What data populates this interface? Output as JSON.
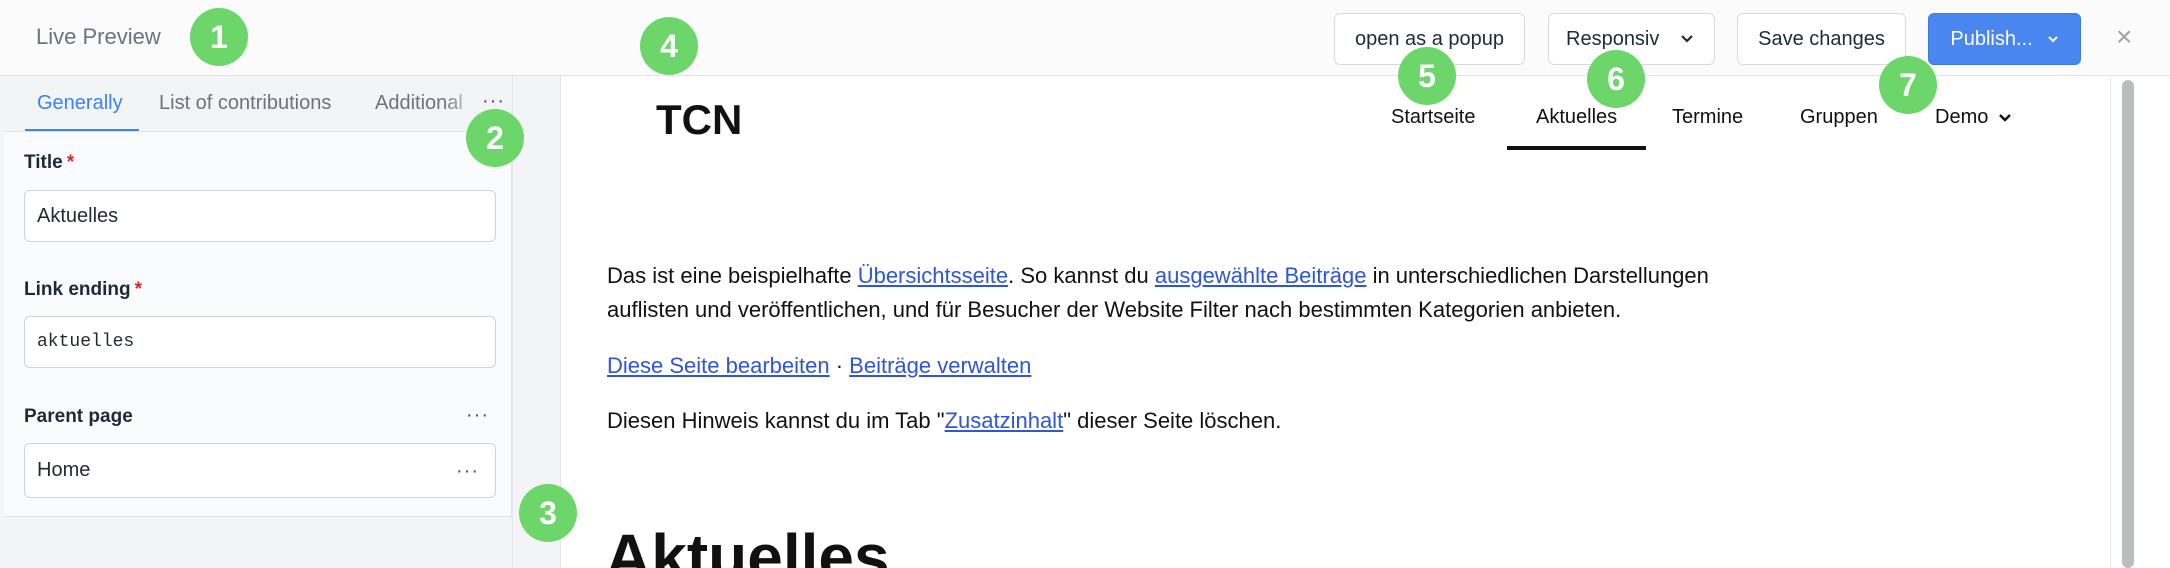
{
  "header": {
    "title": "Live Preview",
    "open_popup_label": "open as a popup",
    "responsive_label": "Responsiv",
    "save_label": "Save changes",
    "publish_label": "Publish...",
    "close_symbol": "×"
  },
  "left_panel": {
    "tabs": [
      "Generally",
      "List of contributions",
      "Additional"
    ],
    "more_symbol": "···",
    "fields": {
      "title": {
        "label": "Title",
        "required": "*",
        "value": "Aktuelles"
      },
      "link_ending": {
        "label": "Link ending",
        "required": "*",
        "value": "aktuelles"
      },
      "parent_page": {
        "label": "Parent page",
        "value": "Home"
      }
    }
  },
  "preview": {
    "logo": "TCN",
    "nav": [
      "Startseite",
      "Aktuelles",
      "Termine",
      "Gruppen",
      "Demo"
    ],
    "paragraph1": {
      "t1": "Das ist eine beispielhafte ",
      "link1": "Übersichtsseite",
      "t2": ". So kannst du ",
      "link2": "ausgewählte Beiträge",
      "t3": " in unterschiedlichen Darstellungen",
      "line2": "auflisten und veröffentlichen, und für Besucher der Website Filter nach bestimmten Kategorien anbieten."
    },
    "links_line": {
      "link1": "Diese Seite bearbeiten",
      "sep": " · ",
      "link2": "Beiträge verwalten"
    },
    "hint": {
      "t1": "Diesen Hinweis kannst du im Tab \"",
      "link": "Zusatzinhalt",
      "t2": "\" dieser Seite löschen."
    },
    "heading": "Aktuelles"
  },
  "markers": [
    "1",
    "2",
    "3",
    "4",
    "5",
    "6",
    "7"
  ],
  "colors": {
    "accent": "#3b82f6",
    "publish": "#4a86f0",
    "marker": "#6cd66b",
    "link": "#2f56d3",
    "required": "#dc2626"
  }
}
